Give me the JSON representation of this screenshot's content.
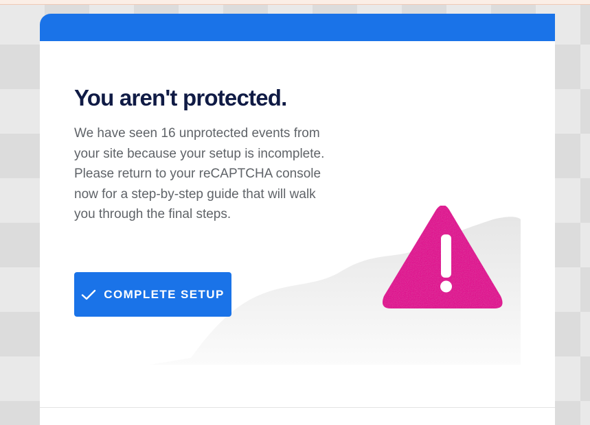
{
  "alert": {
    "title": "You aren't protected.",
    "description": "We have seen 16 unprotected events from your site because your setup is incomplete. Please return to your reCAPTCHA console now for a step-by-step guide that will walk you through the final steps.",
    "button": {
      "label": "COMPLETE SETUP",
      "icon": "check-icon"
    },
    "illustration_icon": "warning-triangle-icon"
  },
  "colors": {
    "header": "#1a73e8",
    "title": "#101b45",
    "body_text": "#5f6368",
    "button": "#1a73e8",
    "warning": "#e5008a"
  }
}
